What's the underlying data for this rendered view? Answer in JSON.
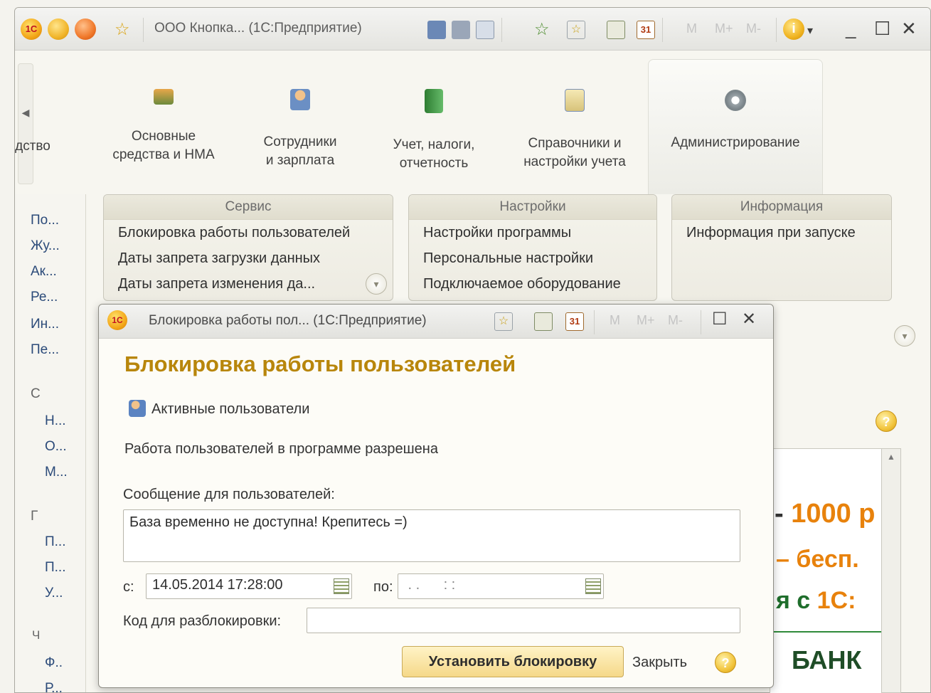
{
  "main_window": {
    "title": "ООО Кнопка... (1С:Предприятие)",
    "m_buttons": [
      "M",
      "M+",
      "M-"
    ],
    "controls": {
      "minimize": "_",
      "maximize": "☐",
      "close": "✕"
    }
  },
  "sections": [
    {
      "line1": "дство",
      "line2": ""
    },
    {
      "line1": "Основные",
      "line2": "средства и НМА"
    },
    {
      "line1": "Сотрудники",
      "line2": "и зарплата"
    },
    {
      "line1": "Учет, налоги,",
      "line2": "отчетность"
    },
    {
      "line1": "Справочники и",
      "line2": "настройки учета"
    },
    {
      "line1": "Администрирование",
      "line2": ""
    }
  ],
  "groups": {
    "service": {
      "title": "Сервис",
      "items": [
        "Блокировка работы пользователей",
        "Даты запрета загрузки данных",
        "Даты запрета изменения да..."
      ]
    },
    "settings": {
      "title": "Настройки",
      "items": [
        "Настройки программы",
        "Персональные настройки",
        "Подключаемое оборудование"
      ]
    },
    "info": {
      "title": "Информация",
      "items": [
        "Информация при запуске"
      ]
    }
  },
  "left_nav": {
    "items": [
      "По...",
      "Жу...",
      "Ак...",
      "Ре...",
      "Ин...",
      "Пе..."
    ],
    "group_c": "С",
    "items_c": [
      "Н...",
      "О...",
      "М..."
    ],
    "group_g": "Г",
    "items_g": [
      "П...",
      "П...",
      "У..."
    ],
    "group_ch": "Ч",
    "items_ch": [
      "Ф..",
      "Р..."
    ]
  },
  "ad": {
    "line1": "1000 р",
    "line2": "– бесп.",
    "line3_prefix": "я с ",
    "line3_accent": "1С:",
    "line4": "БАНК"
  },
  "modal": {
    "title": "Блокировка работы пол... (1С:Предприятие)",
    "m_buttons": [
      "M",
      "M+",
      "M-"
    ],
    "heading": "Блокировка работы пользователей",
    "active_users_link": "Активные пользователи",
    "status": "Работа пользователей в программе разрешена",
    "message_label": "Сообщение для пользователей:",
    "message_value": "База временно не доступна! Крепитесь =)",
    "from_label": "с:",
    "from_value": "14.05.2014 17:28:00",
    "to_label": "по:",
    "to_value": " . .      : :",
    "unlock_code_label": "Код для разблокировки:",
    "unlock_code_value": "",
    "set_lock_button": "Установить блокировку",
    "close_button": "Закрыть",
    "help": "?"
  },
  "colors": {
    "heading": "#b8860b",
    "ad_orange": "#e8820c",
    "ad_green": "#1f6e2c",
    "button_gradient": "#f5d889"
  }
}
